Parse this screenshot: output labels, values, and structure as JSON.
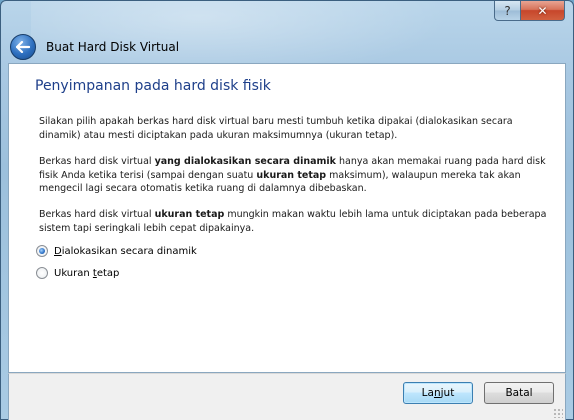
{
  "window": {
    "help_label": "?",
    "close_label": "✕"
  },
  "wizard": {
    "title": "Buat Hard Disk Virtual",
    "back_icon": "back-arrow-icon"
  },
  "page": {
    "section_title": "Penyimpanan pada hard disk fisik",
    "para1": "Silakan pilih apakah berkas hard disk virtual baru mesti tumbuh ketika dipakai (dialokasikan secara dinamik) atau mesti diciptakan pada ukuran maksimumnya (ukuran tetap).",
    "para2": {
      "t1": "Berkas hard disk virtual ",
      "b1": "yang dialokasikan secara dinamik",
      "t2": " hanya akan memakai ruang pada hard disk fisik Anda ketika terisi (sampai dengan suatu ",
      "b2": "ukuran tetap",
      "t3": " maksimum), walaupun mereka tak akan mengecil lagi secara otomatis ketika ruang di dalamnya dibebaskan."
    },
    "para3": {
      "t1": "Berkas hard disk virtual ",
      "b1": "ukuran tetap",
      "t2": " mungkin makan waktu lebih lama untuk diciptakan pada beberapa sistem tapi seringkali lebih cepat dipakainya."
    },
    "options": [
      {
        "pre": "",
        "mnemonic": "D",
        "post": "ialokasikan secara dinamik",
        "selected": true
      },
      {
        "pre": "Ukuran ",
        "mnemonic": "t",
        "post": "etap",
        "selected": false
      }
    ]
  },
  "footer": {
    "next": {
      "pre": "La",
      "mnemonic": "n",
      "post": "jut"
    },
    "cancel_label": "Batal"
  },
  "colors": {
    "title_blue": "#1e3f8a",
    "frame_glass": "#a8c8e2",
    "close_red": "#c7462b"
  }
}
